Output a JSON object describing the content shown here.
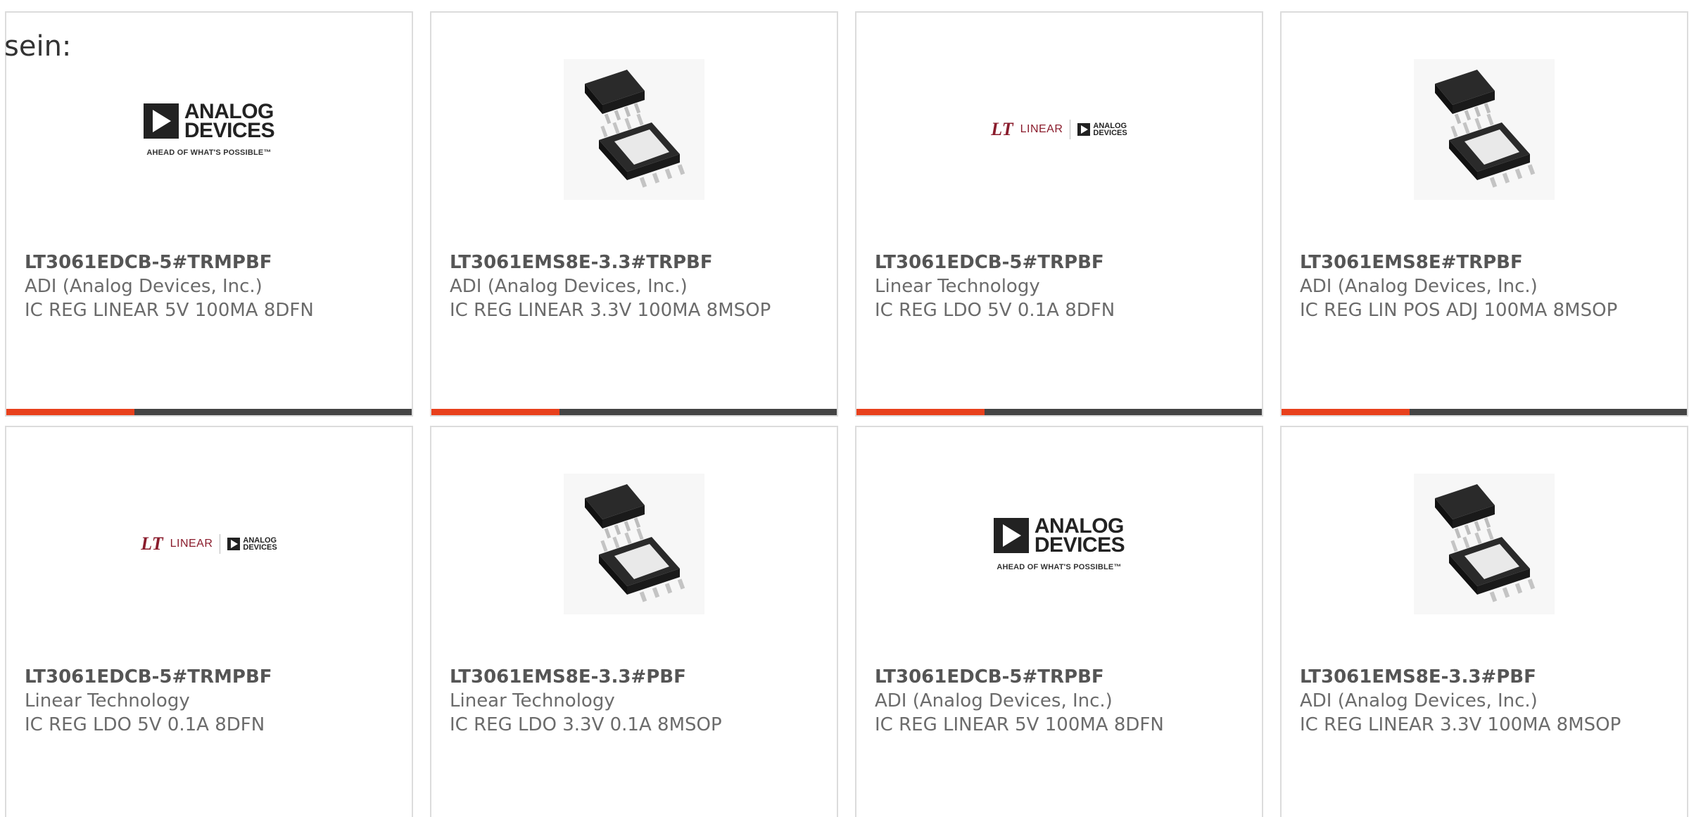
{
  "intro_text": "sein:",
  "accent_color": "#e8401c",
  "bar_color": "#444444",
  "logos": {
    "adi": {
      "line1": "ANALOG",
      "line2": "DEVICES",
      "tagline": "AHEAD OF WHAT'S POSSIBLE™"
    },
    "linear": {
      "mark": "LT",
      "word": "LINEAR",
      "adi_line1": "ANALOG",
      "adi_line2": "DEVICES"
    }
  },
  "products": [
    {
      "part": "LT3061EDCB-5#TRMPBF",
      "manufacturer": "ADI (Analog Devices, Inc.)",
      "description": "IC REG LINEAR 5V 100MA 8DFN",
      "image": "adi-logo"
    },
    {
      "part": "LT3061EMS8E-3.3#TRPBF",
      "manufacturer": "ADI (Analog Devices, Inc.)",
      "description": "IC REG LINEAR 3.3V 100MA 8MSOP",
      "image": "msop-chip"
    },
    {
      "part": "LT3061EDCB-5#TRPBF",
      "manufacturer": "Linear Technology",
      "description": "IC REG LDO 5V 0.1A 8DFN",
      "image": "linear-logo"
    },
    {
      "part": "LT3061EMS8E#TRPBF",
      "manufacturer": "ADI (Analog Devices, Inc.)",
      "description": "IC REG LIN POS ADJ 100MA 8MSOP",
      "image": "msop-chip"
    },
    {
      "part": "LT3061EDCB-5#TRMPBF",
      "manufacturer": "Linear Technology",
      "description": "IC REG LDO 5V 0.1A 8DFN",
      "image": "linear-logo"
    },
    {
      "part": "LT3061EMS8E-3.3#PBF",
      "manufacturer": "Linear Technology",
      "description": "IC REG LDO 3.3V 0.1A 8MSOP",
      "image": "msop-chip"
    },
    {
      "part": "LT3061EDCB-5#TRPBF",
      "manufacturer": "ADI (Analog Devices, Inc.)",
      "description": "IC REG LINEAR 5V 100MA 8DFN",
      "image": "adi-logo"
    },
    {
      "part": "LT3061EMS8E-3.3#PBF",
      "manufacturer": "ADI (Analog Devices, Inc.)",
      "description": "IC REG LINEAR 3.3V 100MA 8MSOP",
      "image": "msop-chip"
    }
  ]
}
